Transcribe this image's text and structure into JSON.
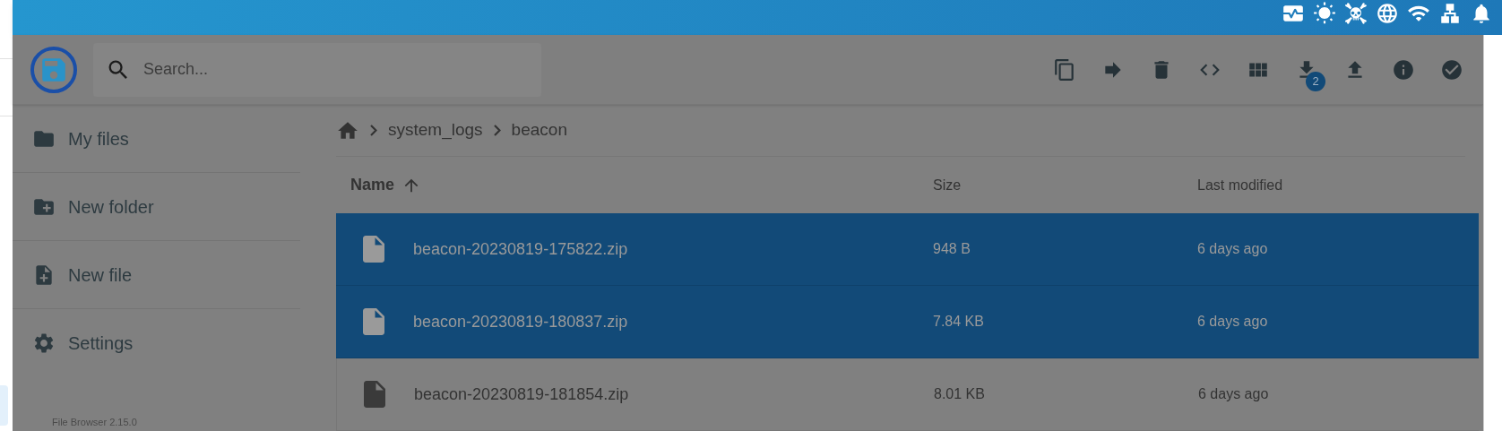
{
  "search": {
    "placeholder": "Search..."
  },
  "toolbar": {
    "download_badge": "2"
  },
  "sidebar": {
    "items": [
      {
        "label": "My files",
        "kind": "files"
      },
      {
        "label": "New folder",
        "kind": "new-folder"
      },
      {
        "label": "New file",
        "kind": "new-file"
      },
      {
        "label": "Settings",
        "kind": "settings"
      }
    ],
    "version": "File Browser 2.15.0"
  },
  "breadcrumbs": [
    "system_logs",
    "beacon"
  ],
  "table": {
    "columns": [
      "Name",
      "Size",
      "Last modified"
    ],
    "rows": [
      {
        "name": "beacon-20230819-175822.zip",
        "size": "948 B",
        "modified": "6 days ago",
        "selected": true
      },
      {
        "name": "beacon-20230819-180837.zip",
        "size": "7.84 KB",
        "modified": "6 days ago",
        "selected": true
      },
      {
        "name": "beacon-20230819-181854.zip",
        "size": "8.01 KB",
        "modified": "6 days ago",
        "selected": false
      }
    ]
  }
}
